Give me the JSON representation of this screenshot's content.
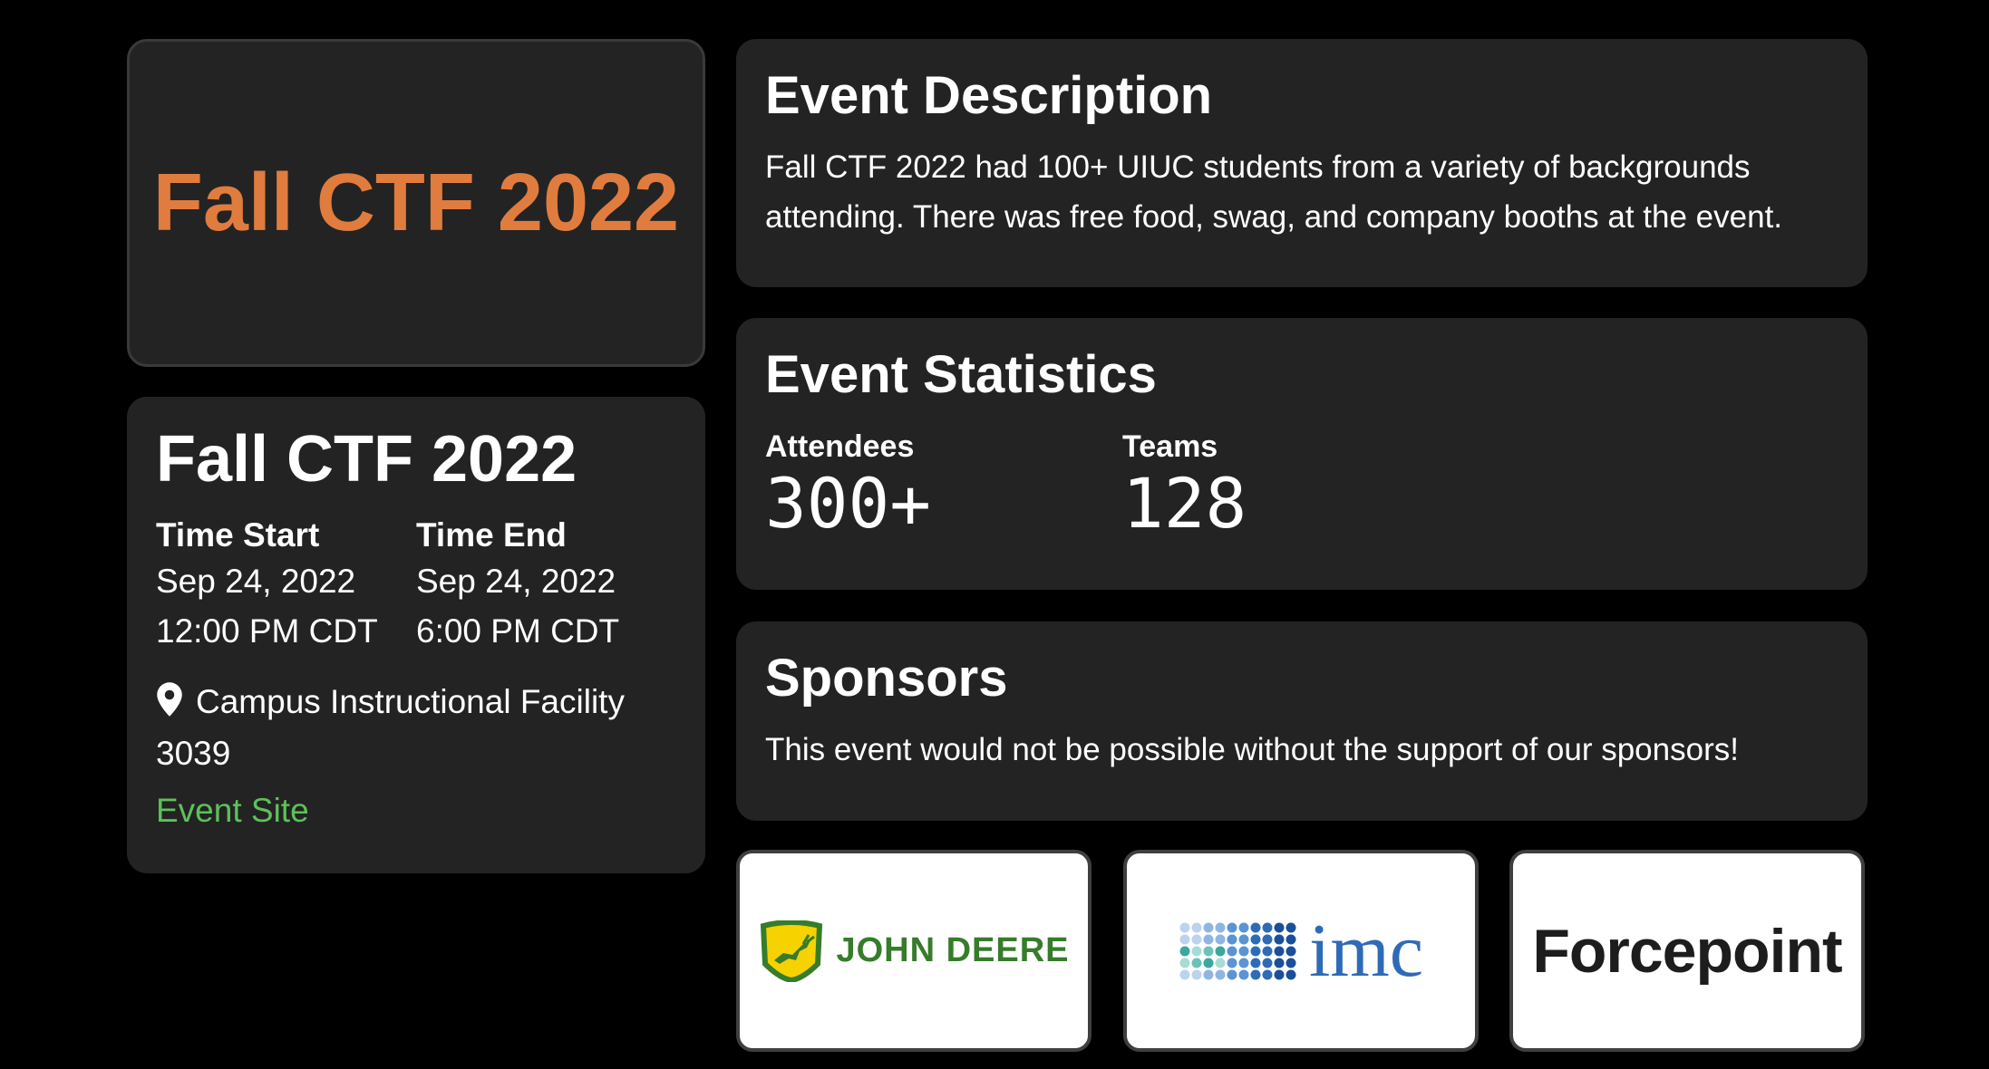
{
  "banner": {
    "title": "Fall CTF 2022",
    "title_color": "#e07c3e"
  },
  "event": {
    "title": "Fall CTF 2022",
    "time_start": {
      "label": "Time Start",
      "date": "Sep 24, 2022",
      "time": "12:00 PM CDT"
    },
    "time_end": {
      "label": "Time End",
      "date": "Sep 24, 2022",
      "time": "6:00 PM CDT"
    },
    "location_icon": "map-pin-icon",
    "location": "Campus Instructional Facility 3039",
    "site_link": "Event Site",
    "link_color": "#5dc15a"
  },
  "description": {
    "title": "Event Description",
    "text": "Fall CTF 2022 had 100+ UIUC students from a variety of backgrounds attending. There was free food, swag, and company booths at the event."
  },
  "statistics": {
    "title": "Event Statistics",
    "items": [
      {
        "label": "Attendees",
        "value": "300+"
      },
      {
        "label": "Teams",
        "value": "128"
      }
    ]
  },
  "sponsors": {
    "title": "Sponsors",
    "text": "This event would not be possible without the support of our sponsors!",
    "logos": [
      {
        "name": "JOHN DEERE",
        "icon": "deer-logo-icon",
        "color": "#367c2b"
      },
      {
        "name": "imc",
        "icon": "dot-grid-logo-icon",
        "color": "#2e6bb7"
      },
      {
        "name": "Forcepoint",
        "color": "#1d1d1d"
      }
    ]
  }
}
